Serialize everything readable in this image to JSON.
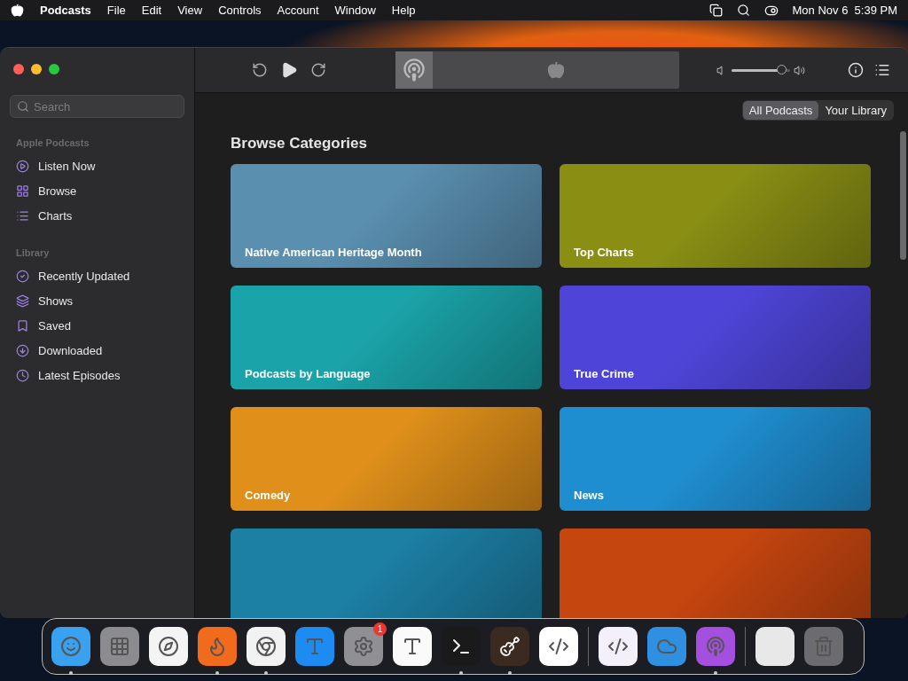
{
  "menu_bar": {
    "app_name": "Podcasts",
    "menus": [
      "File",
      "Edit",
      "View",
      "Controls",
      "Account",
      "Window",
      "Help"
    ],
    "clock": "Mon Nov 6  5:39 PM"
  },
  "sidebar": {
    "search": {
      "placeholder": "Search"
    },
    "sections": [
      {
        "title": "Apple Podcasts",
        "items": [
          "Listen Now",
          "Browse",
          "Charts"
        ]
      },
      {
        "title": "Library",
        "items": [
          "Recently Updated",
          "Shows",
          "Saved",
          "Downloaded",
          "Latest Episodes"
        ]
      }
    ]
  },
  "toolbar": {
    "volume": {
      "level": 0.85
    }
  },
  "scope": [
    {
      "label": "All Podcasts",
      "selected": true
    },
    {
      "label": "Your Library",
      "selected": false
    }
  ],
  "content": {
    "title": "Browse Categories",
    "cards": [
      {
        "label": "Native American Heritage Month",
        "color": "#5a8fb0"
      },
      {
        "label": "Top Charts",
        "color": "#8a8f14"
      },
      {
        "label": "Podcasts by Language",
        "color": "#1aa3a8"
      },
      {
        "label": "True Crime",
        "color": "#4e45d8"
      },
      {
        "label": "Comedy",
        "color": "#e0901a"
      },
      {
        "label": "News",
        "color": "#1f8ed0"
      },
      {
        "color": "#1c7fa4"
      },
      {
        "color": "#c6460f"
      }
    ]
  },
  "dock": [
    {
      "kind": "app",
      "color": "#3aa0f0",
      "running": true
    },
    {
      "kind": "app",
      "color": "#8c8c90",
      "running": false
    },
    {
      "kind": "app",
      "color": "#f4f4f4",
      "running": false
    },
    {
      "kind": "app",
      "color": "#f26a1b",
      "running": true
    },
    {
      "kind": "app",
      "color": "#f2f2f2",
      "running": true
    },
    {
      "kind": "app",
      "color": "#1c8cf2",
      "running": false
    },
    {
      "kind": "app",
      "color": "#8f8f94",
      "running": false,
      "badge": "1"
    },
    {
      "kind": "app",
      "color": "#fafafa",
      "running": false
    },
    {
      "kind": "app",
      "color": "#1a1a1a",
      "running": true
    },
    {
      "kind": "app",
      "color": "#3b2a20",
      "running": true
    },
    {
      "kind": "app",
      "color": "#ffffff",
      "running": false
    },
    {
      "kind": "separator"
    },
    {
      "kind": "app",
      "color": "#f4f0fa",
      "running": false
    },
    {
      "kind": "app",
      "color": "#2f8fe0",
      "running": false
    },
    {
      "kind": "app",
      "color": "#a44fe0",
      "running": true
    },
    {
      "kind": "separator"
    },
    {
      "kind": "preview",
      "color": "#e8e8e8",
      "running": false
    },
    {
      "kind": "app",
      "color": "#6b6b70",
      "running": false
    }
  ]
}
